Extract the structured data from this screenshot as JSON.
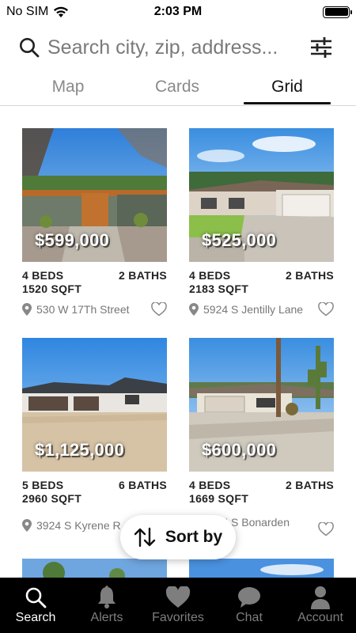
{
  "status_bar": {
    "carrier": "No SIM",
    "time": "2:03 PM"
  },
  "search": {
    "placeholder": "Search city, zip, address..."
  },
  "tabs": [
    {
      "label": "Map"
    },
    {
      "label": "Cards"
    },
    {
      "label": "Grid",
      "active": true
    }
  ],
  "listings": [
    {
      "price": "$599,000",
      "beds": "4 BEDS",
      "baths": "2 BATHS",
      "sqft": "1520 SQFT",
      "address": "530 W 17Th Street"
    },
    {
      "price": "$525,000",
      "beds": "4 BEDS",
      "baths": "2 BATHS",
      "sqft": "2183 SQFT",
      "address": "5924 S Jentilly Lane"
    },
    {
      "price": "$1,125,000",
      "beds": "5 BEDS",
      "baths": "6 BATHS",
      "sqft": "2960 SQFT",
      "address": "3924 S Kyrene R"
    },
    {
      "price": "$600,000",
      "beds": "4 BEDS",
      "baths": "2 BATHS",
      "sqft": "1669 SQFT",
      "address": "6225 S Bonarden"
    }
  ],
  "sort_button": {
    "label": "Sort by"
  },
  "bottom_nav": [
    {
      "label": "Search",
      "icon": "search-icon",
      "active": true
    },
    {
      "label": "Alerts",
      "icon": "bell-icon"
    },
    {
      "label": "Favorites",
      "icon": "heart-icon"
    },
    {
      "label": "Chat",
      "icon": "chat-bubble-icon"
    },
    {
      "label": "Account",
      "icon": "person-icon"
    }
  ],
  "colors": {
    "nav_bg": "#000000",
    "nav_active": "#ffffff",
    "nav_inactive": "#7e7e7e",
    "tab_active": "#111111",
    "tab_inactive": "#8a8a8a"
  }
}
